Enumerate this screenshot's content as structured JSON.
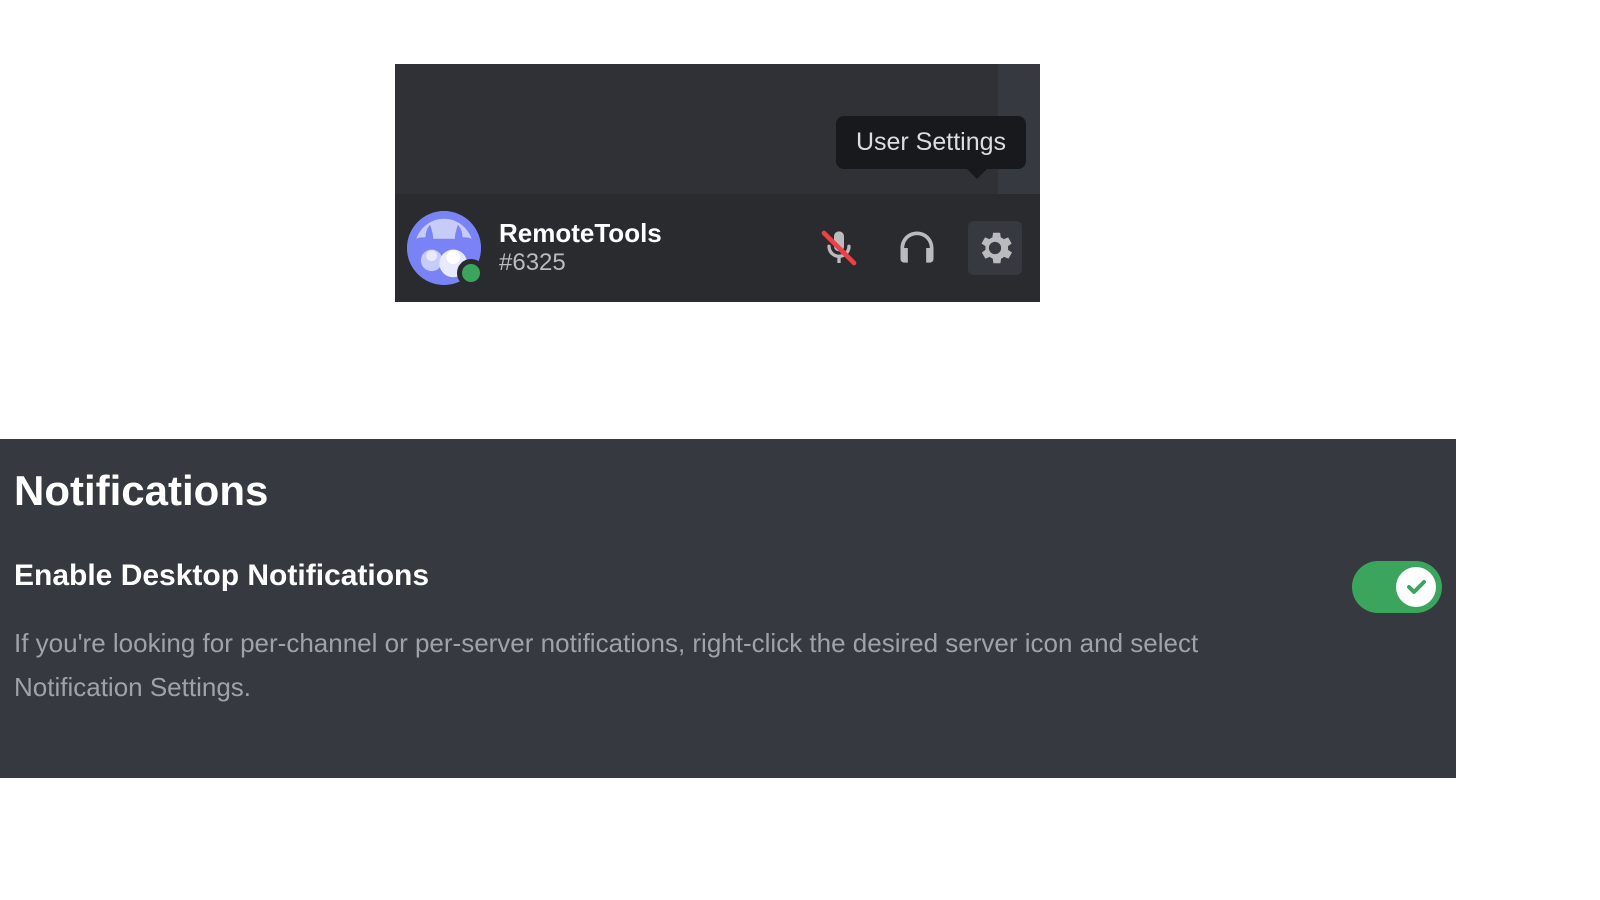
{
  "tooltip": {
    "text": "User Settings"
  },
  "user": {
    "name": "RemoteTools",
    "discriminator": "#6325"
  },
  "settings": {
    "title": "Notifications",
    "desktop": {
      "label": "Enable Desktop Notifications",
      "description": "If you're looking for per-channel or per-server notifications, right-click the desired server icon and select Notification Settings."
    }
  },
  "colors": {
    "accent": "#3ba55d"
  }
}
